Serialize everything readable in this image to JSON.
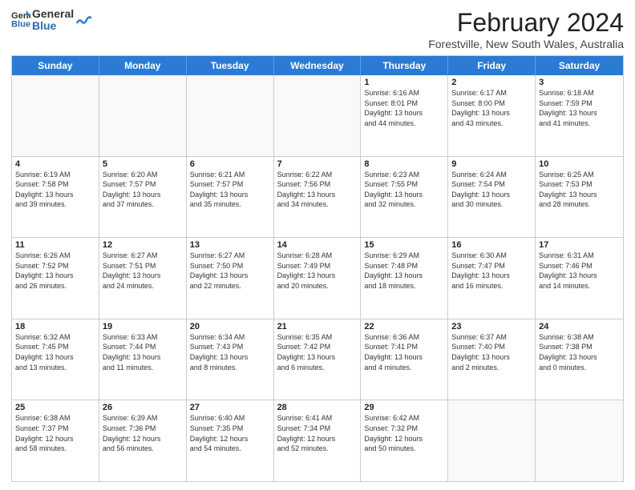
{
  "header": {
    "logo_general": "General",
    "logo_blue": "Blue",
    "month_year": "February 2024",
    "location": "Forestville, New South Wales, Australia"
  },
  "days_of_week": [
    "Sunday",
    "Monday",
    "Tuesday",
    "Wednesday",
    "Thursday",
    "Friday",
    "Saturday"
  ],
  "weeks": [
    [
      {
        "day": "",
        "info": ""
      },
      {
        "day": "",
        "info": ""
      },
      {
        "day": "",
        "info": ""
      },
      {
        "day": "",
        "info": ""
      },
      {
        "day": "1",
        "info": "Sunrise: 6:16 AM\nSunset: 8:01 PM\nDaylight: 13 hours\nand 44 minutes."
      },
      {
        "day": "2",
        "info": "Sunrise: 6:17 AM\nSunset: 8:00 PM\nDaylight: 13 hours\nand 43 minutes."
      },
      {
        "day": "3",
        "info": "Sunrise: 6:18 AM\nSunset: 7:59 PM\nDaylight: 13 hours\nand 41 minutes."
      }
    ],
    [
      {
        "day": "4",
        "info": "Sunrise: 6:19 AM\nSunset: 7:58 PM\nDaylight: 13 hours\nand 39 minutes."
      },
      {
        "day": "5",
        "info": "Sunrise: 6:20 AM\nSunset: 7:57 PM\nDaylight: 13 hours\nand 37 minutes."
      },
      {
        "day": "6",
        "info": "Sunrise: 6:21 AM\nSunset: 7:57 PM\nDaylight: 13 hours\nand 35 minutes."
      },
      {
        "day": "7",
        "info": "Sunrise: 6:22 AM\nSunset: 7:56 PM\nDaylight: 13 hours\nand 34 minutes."
      },
      {
        "day": "8",
        "info": "Sunrise: 6:23 AM\nSunset: 7:55 PM\nDaylight: 13 hours\nand 32 minutes."
      },
      {
        "day": "9",
        "info": "Sunrise: 6:24 AM\nSunset: 7:54 PM\nDaylight: 13 hours\nand 30 minutes."
      },
      {
        "day": "10",
        "info": "Sunrise: 6:25 AM\nSunset: 7:53 PM\nDaylight: 13 hours\nand 28 minutes."
      }
    ],
    [
      {
        "day": "11",
        "info": "Sunrise: 6:26 AM\nSunset: 7:52 PM\nDaylight: 13 hours\nand 26 minutes."
      },
      {
        "day": "12",
        "info": "Sunrise: 6:27 AM\nSunset: 7:51 PM\nDaylight: 13 hours\nand 24 minutes."
      },
      {
        "day": "13",
        "info": "Sunrise: 6:27 AM\nSunset: 7:50 PM\nDaylight: 13 hours\nand 22 minutes."
      },
      {
        "day": "14",
        "info": "Sunrise: 6:28 AM\nSunset: 7:49 PM\nDaylight: 13 hours\nand 20 minutes."
      },
      {
        "day": "15",
        "info": "Sunrise: 6:29 AM\nSunset: 7:48 PM\nDaylight: 13 hours\nand 18 minutes."
      },
      {
        "day": "16",
        "info": "Sunrise: 6:30 AM\nSunset: 7:47 PM\nDaylight: 13 hours\nand 16 minutes."
      },
      {
        "day": "17",
        "info": "Sunrise: 6:31 AM\nSunset: 7:46 PM\nDaylight: 13 hours\nand 14 minutes."
      }
    ],
    [
      {
        "day": "18",
        "info": "Sunrise: 6:32 AM\nSunset: 7:45 PM\nDaylight: 13 hours\nand 13 minutes."
      },
      {
        "day": "19",
        "info": "Sunrise: 6:33 AM\nSunset: 7:44 PM\nDaylight: 13 hours\nand 11 minutes."
      },
      {
        "day": "20",
        "info": "Sunrise: 6:34 AM\nSunset: 7:43 PM\nDaylight: 13 hours\nand 8 minutes."
      },
      {
        "day": "21",
        "info": "Sunrise: 6:35 AM\nSunset: 7:42 PM\nDaylight: 13 hours\nand 6 minutes."
      },
      {
        "day": "22",
        "info": "Sunrise: 6:36 AM\nSunset: 7:41 PM\nDaylight: 13 hours\nand 4 minutes."
      },
      {
        "day": "23",
        "info": "Sunrise: 6:37 AM\nSunset: 7:40 PM\nDaylight: 13 hours\nand 2 minutes."
      },
      {
        "day": "24",
        "info": "Sunrise: 6:38 AM\nSunset: 7:38 PM\nDaylight: 13 hours\nand 0 minutes."
      }
    ],
    [
      {
        "day": "25",
        "info": "Sunrise: 6:38 AM\nSunset: 7:37 PM\nDaylight: 12 hours\nand 58 minutes."
      },
      {
        "day": "26",
        "info": "Sunrise: 6:39 AM\nSunset: 7:36 PM\nDaylight: 12 hours\nand 56 minutes."
      },
      {
        "day": "27",
        "info": "Sunrise: 6:40 AM\nSunset: 7:35 PM\nDaylight: 12 hours\nand 54 minutes."
      },
      {
        "day": "28",
        "info": "Sunrise: 6:41 AM\nSunset: 7:34 PM\nDaylight: 12 hours\nand 52 minutes."
      },
      {
        "day": "29",
        "info": "Sunrise: 6:42 AM\nSunset: 7:32 PM\nDaylight: 12 hours\nand 50 minutes."
      },
      {
        "day": "",
        "info": ""
      },
      {
        "day": "",
        "info": ""
      }
    ]
  ]
}
